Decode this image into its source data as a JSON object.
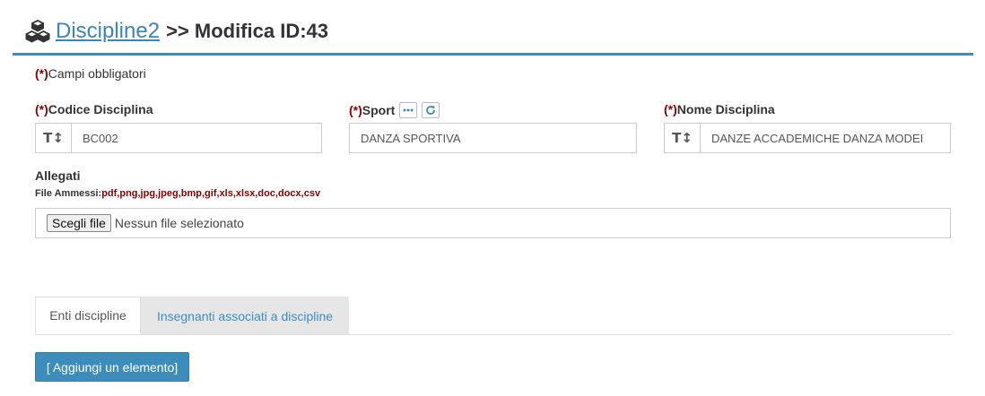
{
  "header": {
    "link": "Discipline2",
    "suffix": ">> Modifica ID:43",
    "icon": "cubes-icon"
  },
  "required_marker": "(*)",
  "required_note": "Campi obbligatori",
  "fields": {
    "codice": {
      "label": "Codice Disciplina",
      "value": "BC002",
      "icon": "text-height-icon"
    },
    "sport": {
      "label": "Sport",
      "value": "DANZA SPORTIVA",
      "icons": [
        "ellipsis-icon",
        "refresh-icon"
      ]
    },
    "nome": {
      "label": "Nome Disciplina",
      "value": "DANZE ACCADEMICHE DANZA MODEI",
      "icon": "text-height-icon"
    }
  },
  "attachments": {
    "label": "Allegati",
    "allowed_prefix": "File Ammessi:",
    "allowed_ext": "pdf,png,jpg,jpeg,bmp,gif,xls,xlsx,doc,docx,csv",
    "button": "Scegli file",
    "status": "Nessun file selezionato"
  },
  "tabs": [
    {
      "label": "Enti discipline",
      "active": true
    },
    {
      "label": "Insegnanti associati a discipline",
      "active": false
    }
  ],
  "add_button": "[ Aggiungi un elemento]",
  "colors": {
    "accent": "#3c8dbc",
    "required": "#8b0000",
    "link": "#3a86b5"
  }
}
